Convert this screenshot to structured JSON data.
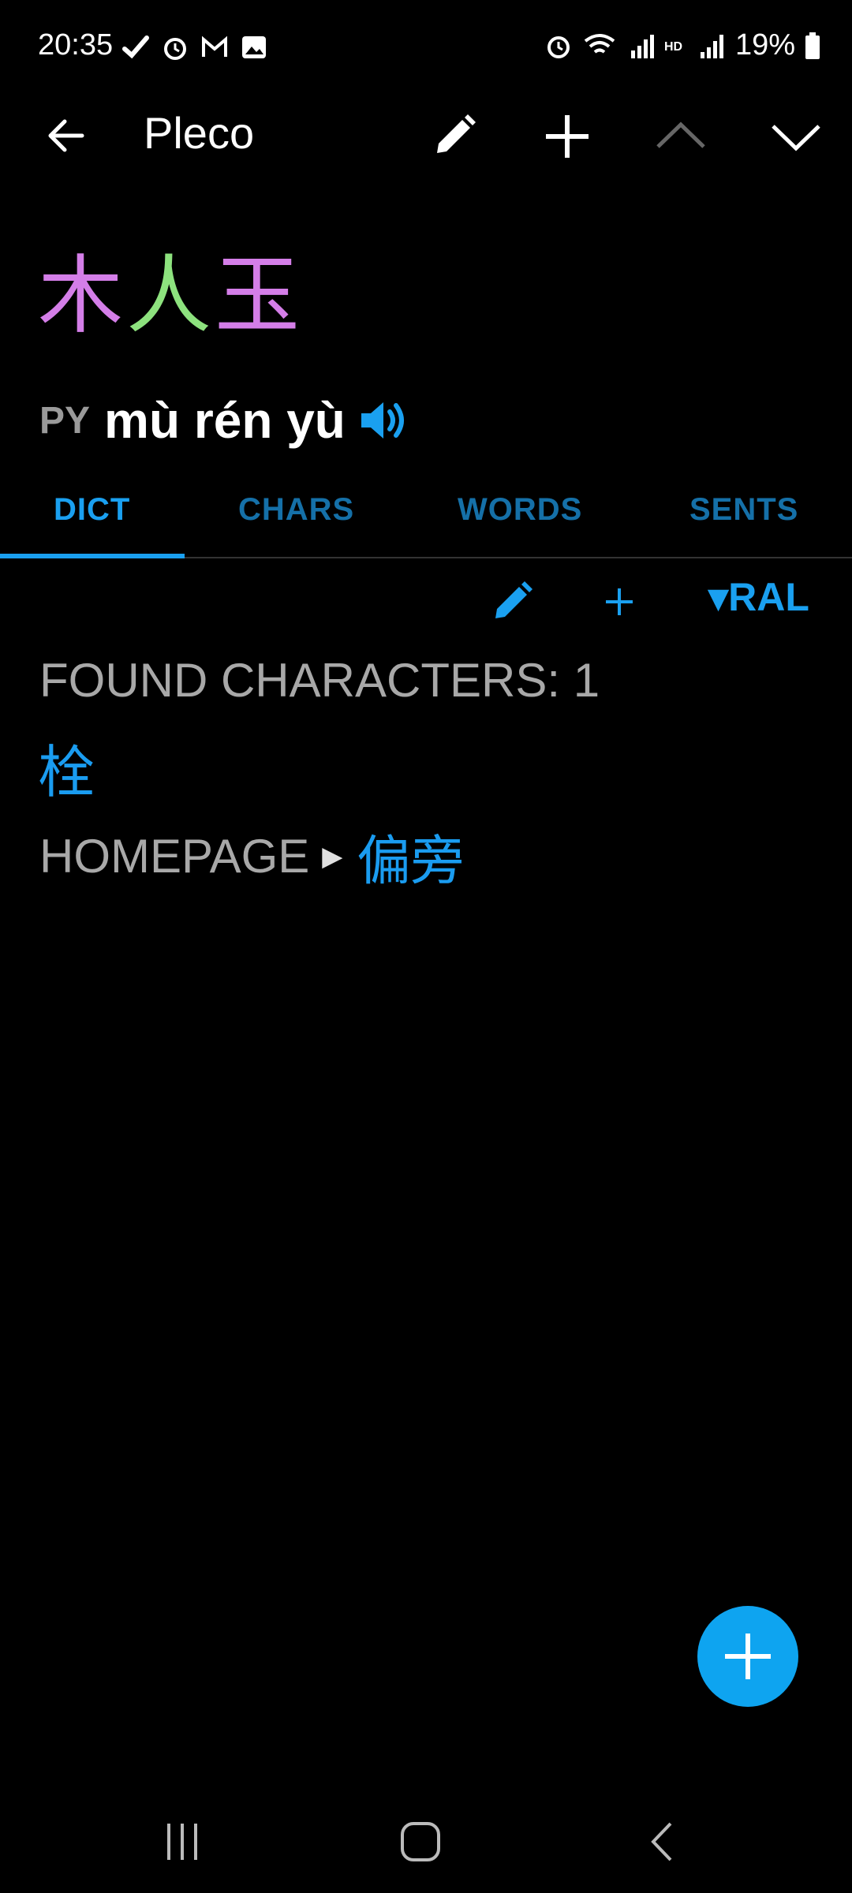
{
  "status_bar": {
    "time": "20:35",
    "battery": "19%",
    "left_icons": [
      "check-icon",
      "alarm-icon",
      "gmail-icon",
      "image-icon"
    ],
    "right_icons": [
      "alarm-icon",
      "wifi-icon",
      "signal-r-icon",
      "hd-icon",
      "signal-icon",
      "battery-icon"
    ]
  },
  "app_bar": {
    "title": "Pleco",
    "back_icon": "arrow-left-icon",
    "actions": [
      "pencil-icon",
      "plus-icon",
      "chevron-up-icon",
      "chevron-down-icon"
    ]
  },
  "entry": {
    "headword_chars": [
      "木",
      "人",
      "玉"
    ],
    "headword_colors": [
      "#d47ee8",
      "#8de27e",
      "#d47ee8"
    ],
    "pinyin_label": "PY",
    "pinyin": "mù rén yù",
    "speaker_icon": "speaker-icon"
  },
  "tabs": [
    {
      "label": "DICT",
      "active": true
    },
    {
      "label": "CHARS",
      "active": false
    },
    {
      "label": "WORDS",
      "active": false
    },
    {
      "label": "SENTS",
      "active": false
    }
  ],
  "subtoolbar": {
    "edit_icon": "pencil-icon",
    "add_icon": "plus-icon",
    "dict_selector": "▾RAL"
  },
  "content": {
    "found_label": "FOUND CHARACTERS: 1",
    "found_chars": [
      "栓"
    ],
    "homepage_label": "HOMEPAGE",
    "homepage_link": "偏旁"
  },
  "fab": {
    "icon": "plus-icon"
  },
  "nav_bar": {
    "buttons": [
      "recents-icon",
      "home-icon",
      "back-icon"
    ]
  },
  "colors": {
    "accent": "#1aa0f0",
    "background": "#000000",
    "muted_text": "#a8a8a8"
  }
}
